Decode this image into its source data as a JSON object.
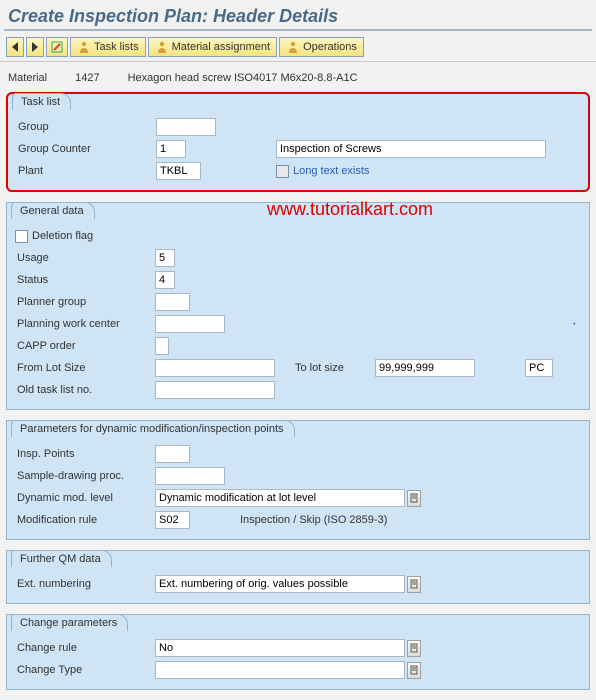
{
  "title": "Create Inspection Plan: Header Details",
  "toolbar": {
    "back_icon": "back-icon",
    "forward_icon": "forward-icon",
    "edit_icon": "edit-icon",
    "task_lists": "Task lists",
    "material_assignment": "Material assignment",
    "operations": "Operations"
  },
  "material": {
    "label": "Material",
    "number": "1427",
    "desc": "Hexagon head screw ISO4017 M6x20-8.8-A1C"
  },
  "task_list": {
    "title": "Task list",
    "group_label": "Group",
    "group_value": "",
    "counter_label": "Group Counter",
    "counter_value": "1",
    "counter_desc": "Inspection of Screws",
    "plant_label": "Plant",
    "plant_value": "TKBL",
    "long_text_label": "Long text exists"
  },
  "general": {
    "title": "General data",
    "deletion_flag_label": "Deletion flag",
    "usage_label": "Usage",
    "usage_value": "5",
    "status_label": "Status",
    "status_value": "4",
    "planner_group_label": "Planner group",
    "planner_group_value": "",
    "planning_wc_label": "Planning work center",
    "planning_wc_value": "",
    "capp_label": "CAPP order",
    "capp_value": "",
    "from_lot_label": "From Lot Size",
    "from_lot_value": "",
    "to_lot_label": "To lot size",
    "to_lot_value": "99,999,999",
    "unit_value": "PC",
    "old_tl_label": "Old task list no.",
    "old_tl_value": ""
  },
  "dynmod": {
    "title": "Parameters for dynamic modification/inspection points",
    "insp_points_label": "Insp. Points",
    "insp_points_value": "",
    "sample_label": "Sample-drawing proc.",
    "sample_value": "",
    "dyn_level_label": "Dynamic mod. level",
    "dyn_level_value": "Dynamic modification at lot level",
    "mod_rule_label": "Modification rule",
    "mod_rule_value": "S02",
    "mod_rule_desc": "Inspection / Skip (ISO 2859-3)"
  },
  "qm": {
    "title": "Further QM data",
    "ext_num_label": "Ext. numbering",
    "ext_num_value": "Ext. numbering of orig. values possible"
  },
  "change": {
    "title": "Change parameters",
    "rule_label": "Change rule",
    "rule_value": "No",
    "type_label": "Change Type",
    "type_value": ""
  },
  "watermark": "www.tutorialkart.com"
}
